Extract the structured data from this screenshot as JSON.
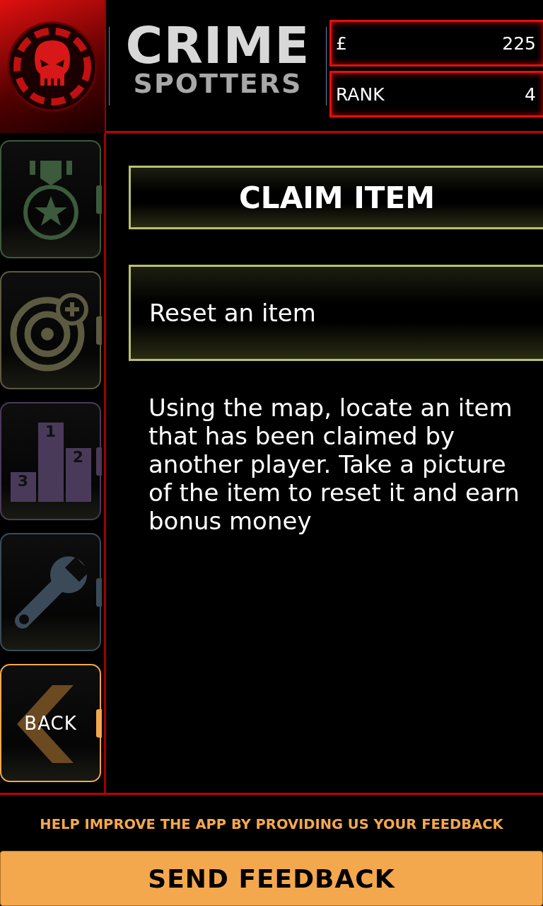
{
  "header": {
    "logo_lines": [
      "CRIME",
      "SPOTTERS"
    ],
    "stats": [
      {
        "label": "£",
        "value": "225"
      },
      {
        "label": "RANK",
        "value": "4"
      }
    ]
  },
  "sidebar": {
    "items": [
      {
        "kind": "medal",
        "color": "#3c5a3c"
      },
      {
        "kind": "target",
        "color": "#5c5a40"
      },
      {
        "kind": "podium",
        "color": "#4a3a5a",
        "places": [
          "1",
          "2",
          "3"
        ]
      },
      {
        "kind": "wrench",
        "color": "#3a4a58"
      },
      {
        "kind": "back",
        "color": "#f3a84e",
        "label": "BACK"
      }
    ]
  },
  "main": {
    "title": "CLAIM ITEM",
    "subtitle": "Reset an item",
    "description": "Using the map, locate an item that has been claimed by another player. Take a picture of the item to reset it and earn bonus money"
  },
  "footer": {
    "prompt": "HELP IMPROVE THE APP BY PROVIDING US YOUR FEEDBACK",
    "button": "SEND FEEDBACK"
  }
}
